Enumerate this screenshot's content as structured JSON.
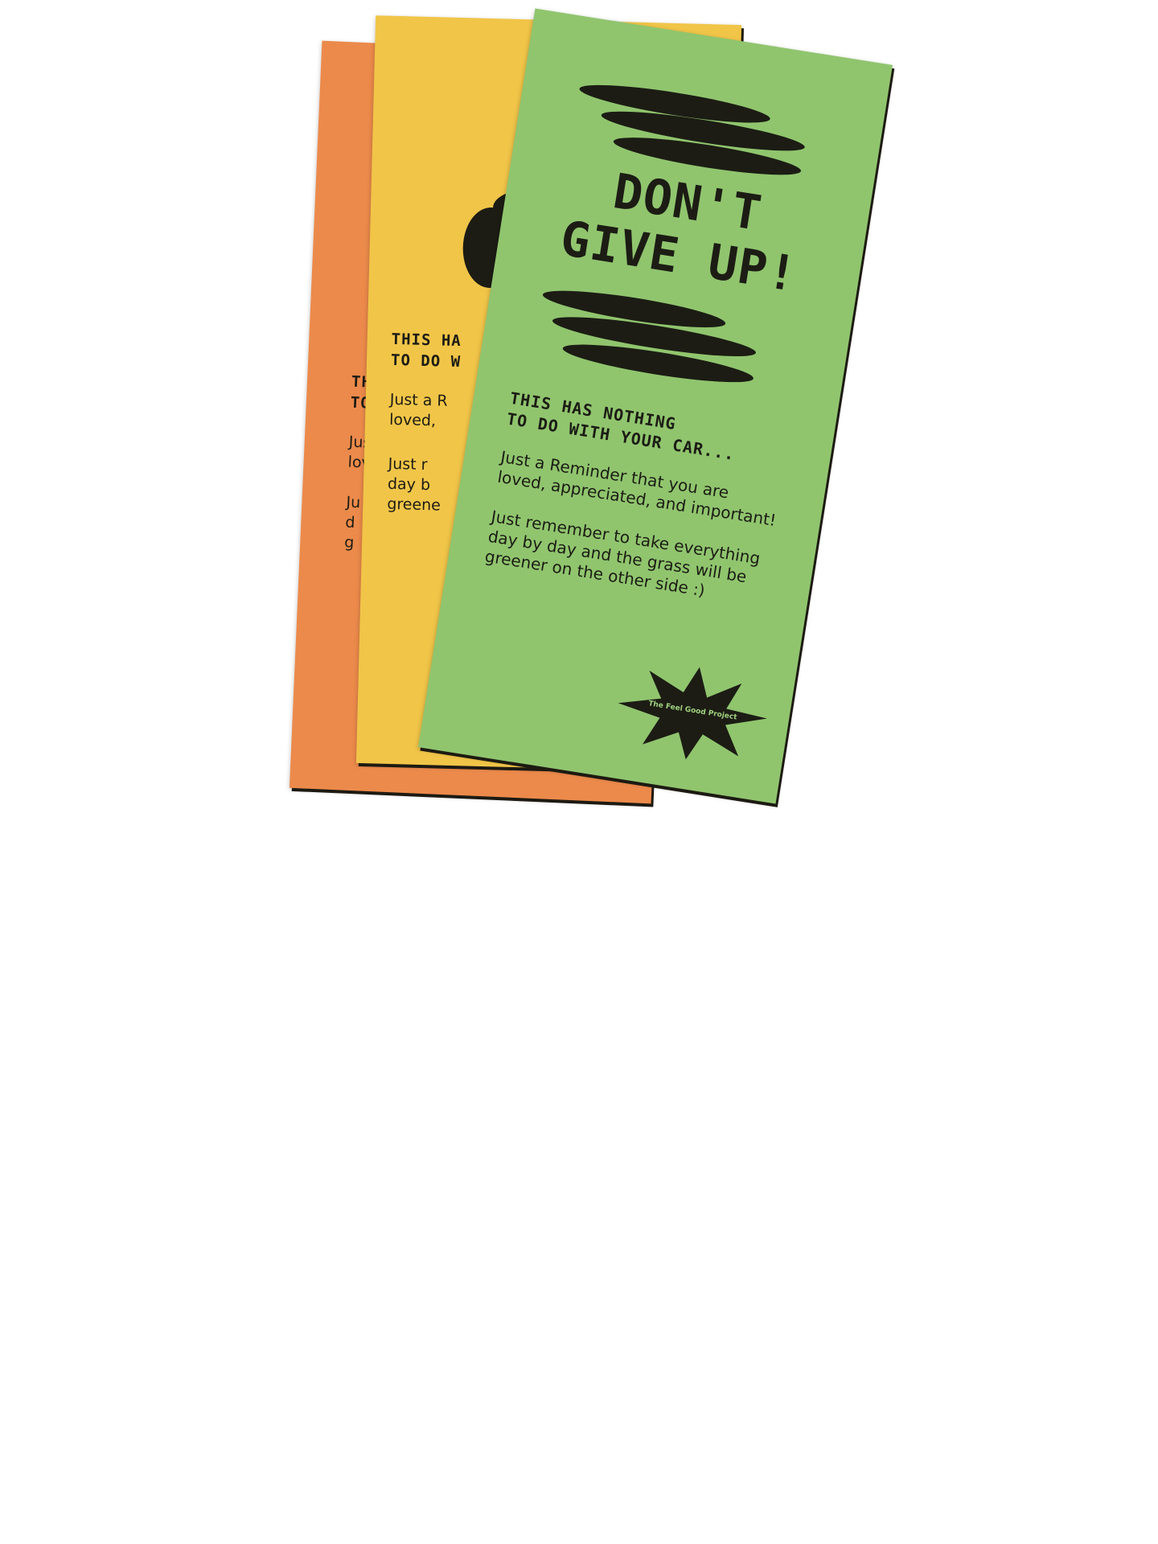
{
  "colors": {
    "orange_card": "#ec8a4b",
    "yellow_card": "#f1c548",
    "green_card": "#90c56e",
    "ink": "#1c1c14"
  },
  "green_card": {
    "title_line1": "DON'T",
    "title_line2": "GIVE UP!",
    "heading_line1": "THIS HAS NOTHING",
    "heading_line2": "TO DO WITH YOUR CAR...",
    "para1_line1": "Just a Reminder that you are",
    "para1_line2": "loved, appreciated, and important!",
    "para2_line1": "Just remember to take everything",
    "para2_line2": "day by day and the grass will be",
    "para2_line3": "greener on the other side :)",
    "badge": "The Feel Good Project",
    "badge_icon": "starburst-icon"
  },
  "yellow_card": {
    "heading_line1": "THIS HA",
    "heading_line2": "TO DO W",
    "para1_line1": "Just a R",
    "para1_line2": "loved,",
    "para2_line1": "Just r",
    "para2_line2": "day b",
    "para2_line3": "greene"
  },
  "orange_card": {
    "heading_line1": "THIS",
    "heading_line2": "TO D",
    "para1_line1": "Just",
    "para1_line2": "lov",
    "para2_line1": "Ju",
    "para2_line2": "d",
    "para2_line3": "g"
  }
}
